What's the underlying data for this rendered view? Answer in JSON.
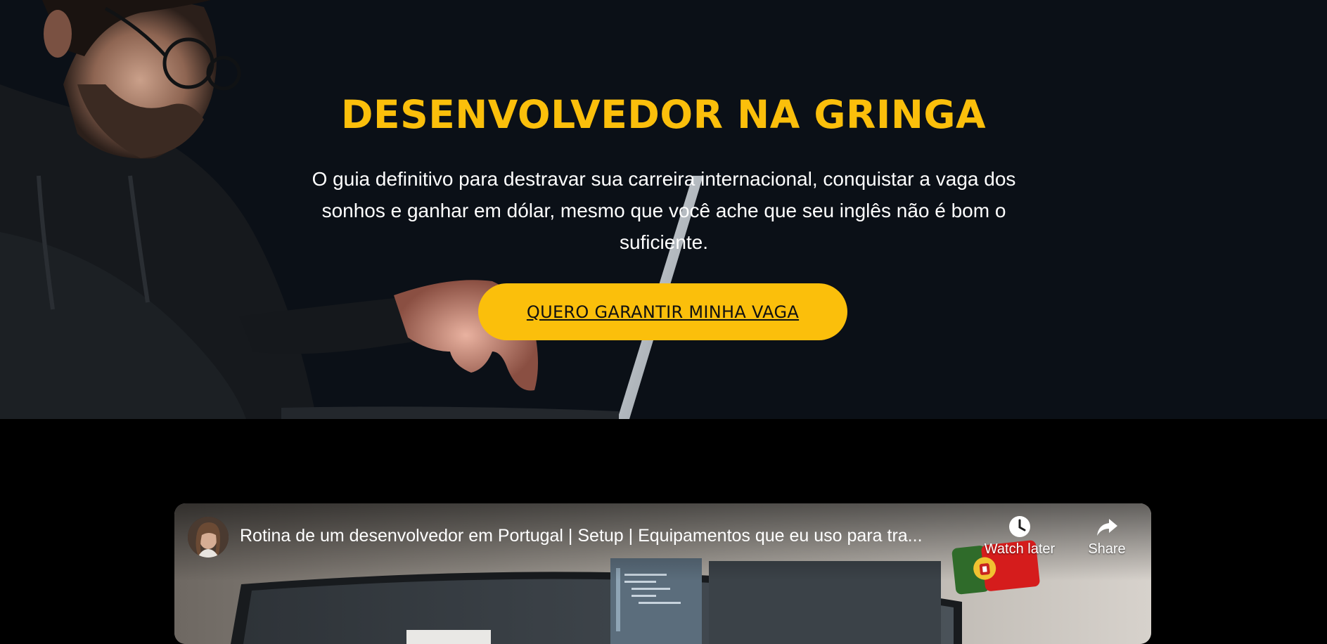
{
  "hero": {
    "title": "DESENVOLVEDOR NA GRINGA",
    "subtitle": "O guia definitivo para destravar sua carreira internacional, conquistar a vaga dos sonhos e ganhar em dólar, mesmo que você ache que seu inglês não é bom o suficiente.",
    "cta_label": "QUERO GARANTIR MINHA VAGA",
    "accent_color": "#fbbf0b",
    "background_color": "#0b1017"
  },
  "video": {
    "title": "Rotina de um desenvolvedor em Portugal | Setup | Equipamentos que eu uso para tra...",
    "watch_later_label": "Watch later",
    "share_label": "Share",
    "icons": [
      "channel-avatar",
      "clock-icon",
      "share-arrow-icon",
      "portugal-flag"
    ]
  }
}
